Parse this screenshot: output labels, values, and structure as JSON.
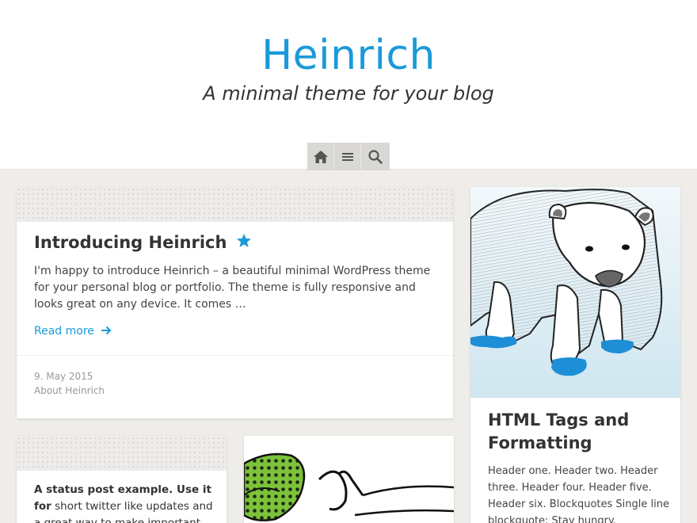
{
  "site": {
    "title": "Heinrich",
    "tagline": "A minimal theme for your blog"
  },
  "nav": {
    "items": [
      {
        "icon": "home-icon"
      },
      {
        "icon": "menu-icon"
      },
      {
        "icon": "search-icon"
      }
    ]
  },
  "posts": {
    "featured": {
      "title": "Introducing Heinrich",
      "sticky_icon": "star-icon",
      "excerpt": "I'm happy to introduce Heinrich – a beautiful minimal WordPress theme for your personal blog or portfolio. The theme is fully responsive and looks great on any device. It comes …",
      "read_more": "Read more",
      "date": "9. May 2015",
      "category": "About Heinrich"
    },
    "html_tags": {
      "title": "HTML Tags and Formatting",
      "excerpt": "Header one. Header two. Header three. Header four. Header five. Header six. Blockquotes Single line blockquote: Stay hungry."
    },
    "status": {
      "text_bold": "A status post example. Use it for",
      "text_rest": " short twitter like updates and a great way to make important an"
    }
  },
  "colors": {
    "accent": "#1a9ad9",
    "background": "#efedea",
    "bear_shoes": "#1e8fd6",
    "leaf_green": "#7cc23a"
  }
}
